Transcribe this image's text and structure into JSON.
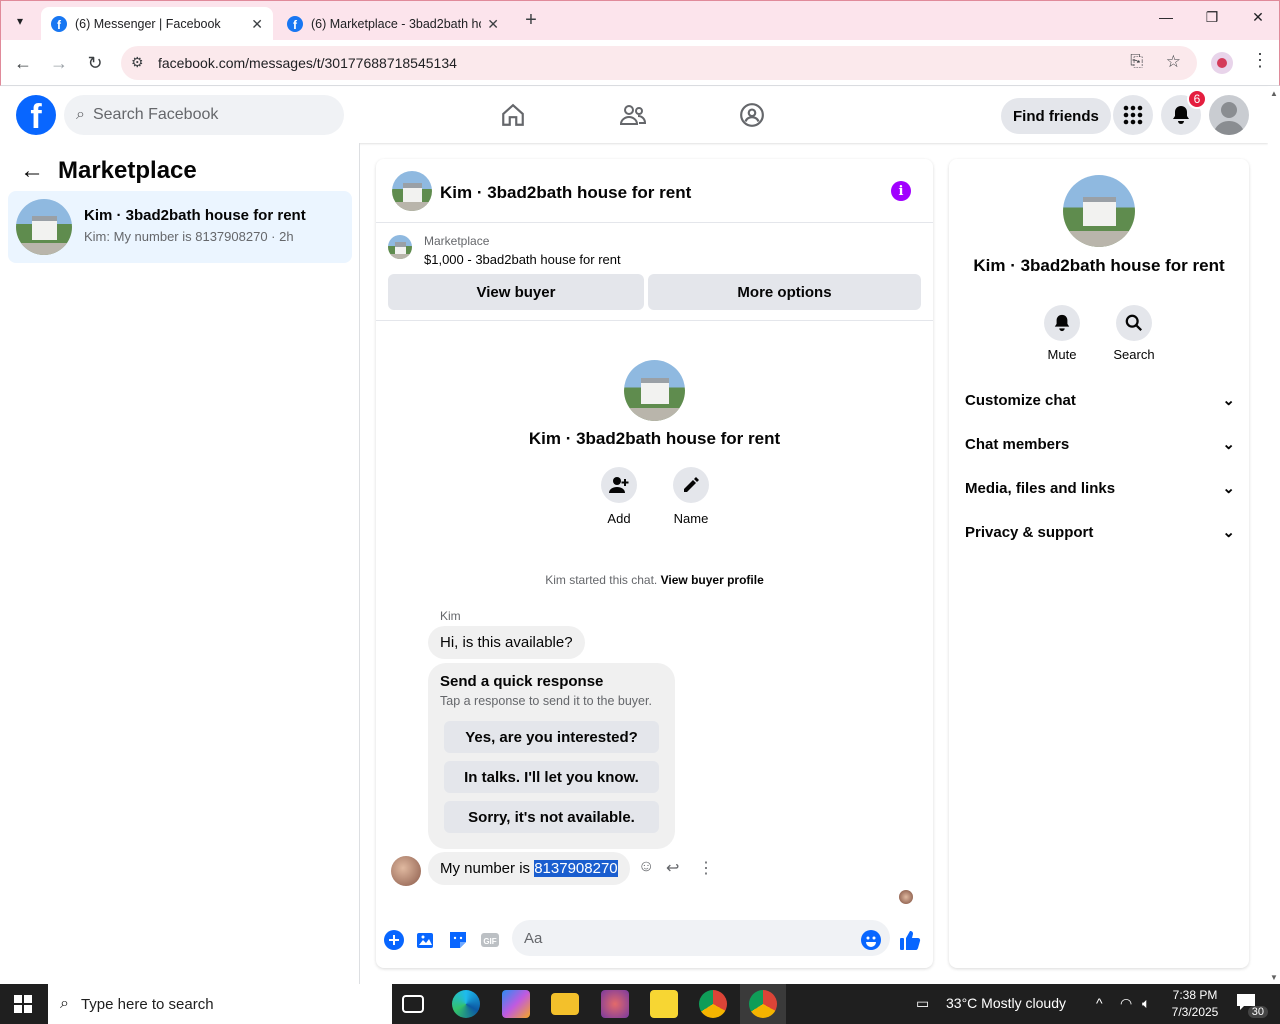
{
  "browser": {
    "tabs": [
      {
        "title": "(6) Messenger | Facebook"
      },
      {
        "title": "(6) Marketplace - 3bad2bath ho"
      }
    ],
    "url": "facebook.com/messages/t/30177688718545134"
  },
  "fb_header": {
    "search_placeholder": "Search Facebook",
    "find_friends": "Find friends",
    "notification_count": "6"
  },
  "sidebar": {
    "title": "Marketplace",
    "conversation": {
      "name": "Kim · 3bad2bath house for rent",
      "preview": "Kim: My number is 8137908270 · 2h"
    }
  },
  "chat": {
    "title": "Kim · 3bad2bath house for rent",
    "marketplace_label": "Marketplace",
    "listing": "$1,000 - 3bad2bath house for rent",
    "view_buyer": "View buyer",
    "more_options": "More options",
    "intro_name": "Kim · 3bad2bath house for rent",
    "add_label": "Add",
    "name_label": "Name",
    "started_text": "Kim started this chat.",
    "view_buyer_profile": "View buyer profile",
    "sender": "Kim",
    "message1": "Hi, is this available?",
    "quick_response": {
      "title": "Send a quick response",
      "subtitle": "Tap a response to send it to the buyer.",
      "options": [
        "Yes, are you interested?",
        "In talks. I'll let you know.",
        "Sorry, it's not available."
      ]
    },
    "message2_prefix": "My number is ",
    "message2_number": "8137908270",
    "composer_placeholder": "Aa"
  },
  "right_panel": {
    "name": "Kim · 3bad2bath house for rent",
    "mute": "Mute",
    "search": "Search",
    "sections": [
      "Customize chat",
      "Chat members",
      "Media, files and links",
      "Privacy & support"
    ]
  },
  "taskbar": {
    "search_placeholder": "Type here to search",
    "weather": "33°C  Mostly cloudy",
    "time": "7:38 PM",
    "date": "7/3/2025",
    "notifications": "30"
  },
  "colors": {
    "fb_blue": "#0866ff",
    "info_purple": "#a100ff",
    "selection": "#1a5ecf",
    "badge_red": "#e41e3f"
  }
}
